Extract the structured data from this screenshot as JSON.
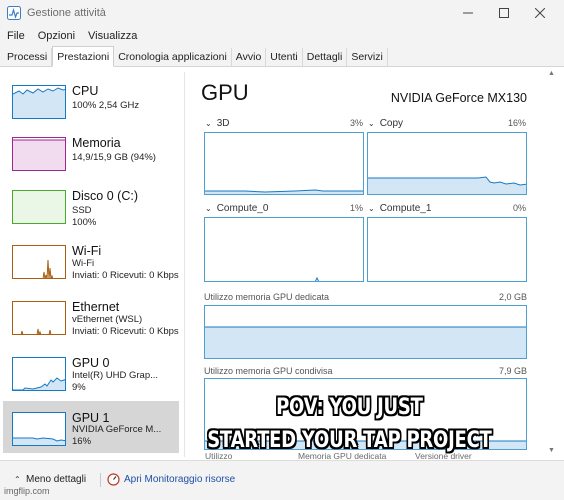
{
  "window": {
    "title": "Gestione attività",
    "controls": [
      "minimize",
      "maximize",
      "close"
    ]
  },
  "menu": [
    "File",
    "Opzioni",
    "Visualizza"
  ],
  "tabs": [
    {
      "label": "Processi",
      "active": false
    },
    {
      "label": "Prestazioni",
      "active": true
    },
    {
      "label": "Cronologia applicazioni",
      "active": false
    },
    {
      "label": "Avvio",
      "active": false
    },
    {
      "label": "Utenti",
      "active": false
    },
    {
      "label": "Dettagli",
      "active": false
    },
    {
      "label": "Servizi",
      "active": false
    }
  ],
  "sidebar": {
    "items": [
      {
        "title": "CPU",
        "line1": "100% 2,54 GHz",
        "line2": "",
        "color": "#1779c4",
        "selected": false
      },
      {
        "title": "Memoria",
        "line1": "14,9/15,9 GB (94%)",
        "line2": "",
        "color": "#a0278f",
        "selected": false
      },
      {
        "title": "Disco 0 (C:)",
        "line1": "SSD",
        "line2": "100%",
        "color": "#4ca82c",
        "selected": false
      },
      {
        "title": "Wi-Fi",
        "line1": "Wi-Fi",
        "line2": "Inviati: 0 Ricevuti: 0 Kbps",
        "color": "#a75e10",
        "selected": false
      },
      {
        "title": "Ethernet",
        "line1": "vEthernet (WSL)",
        "line2": "Inviati: 0 Ricevuti: 0 Kbps",
        "color": "#a75e10",
        "selected": false
      },
      {
        "title": "GPU 0",
        "line1": "Intel(R) UHD Grap...",
        "line2": "9%",
        "color": "#1779c4",
        "selected": false
      },
      {
        "title": "GPU 1",
        "line1": "NVIDIA GeForce M...",
        "line2": "16%",
        "color": "#1779c4",
        "selected": true
      }
    ]
  },
  "main": {
    "title": "GPU",
    "device": "NVIDIA GeForce MX130",
    "engines": [
      {
        "name": "3D",
        "percent": "3%"
      },
      {
        "name": "Copy",
        "percent": "16%"
      },
      {
        "name": "Compute_0",
        "percent": "1%"
      },
      {
        "name": "Compute_1",
        "percent": "0%"
      }
    ],
    "dedicated_memory": {
      "label": "Utilizzo memoria GPU dedicata",
      "value": "2,0 GB"
    },
    "shared_memory": {
      "label": "Utilizzo memoria GPU condivisa",
      "value": "7,9 GB"
    },
    "stat_labels": [
      "Utilizzo",
      "Memoria GPU dedicata",
      "Versione driver"
    ]
  },
  "footer": {
    "fewer_details": "Meno dettagli",
    "resource_monitor": "Apri Monitoraggio risorse"
  },
  "overlay_caption": {
    "line1": "POV: YOU JUST",
    "line2": "STARTED YOUR TAP PROJECT"
  },
  "watermark": "imgflip.com",
  "colors": {
    "graph_line": "#1779c4",
    "graph_border": "#4f9fd1",
    "graph_fill": "#d3e6f5",
    "link": "#1f4fa8"
  }
}
